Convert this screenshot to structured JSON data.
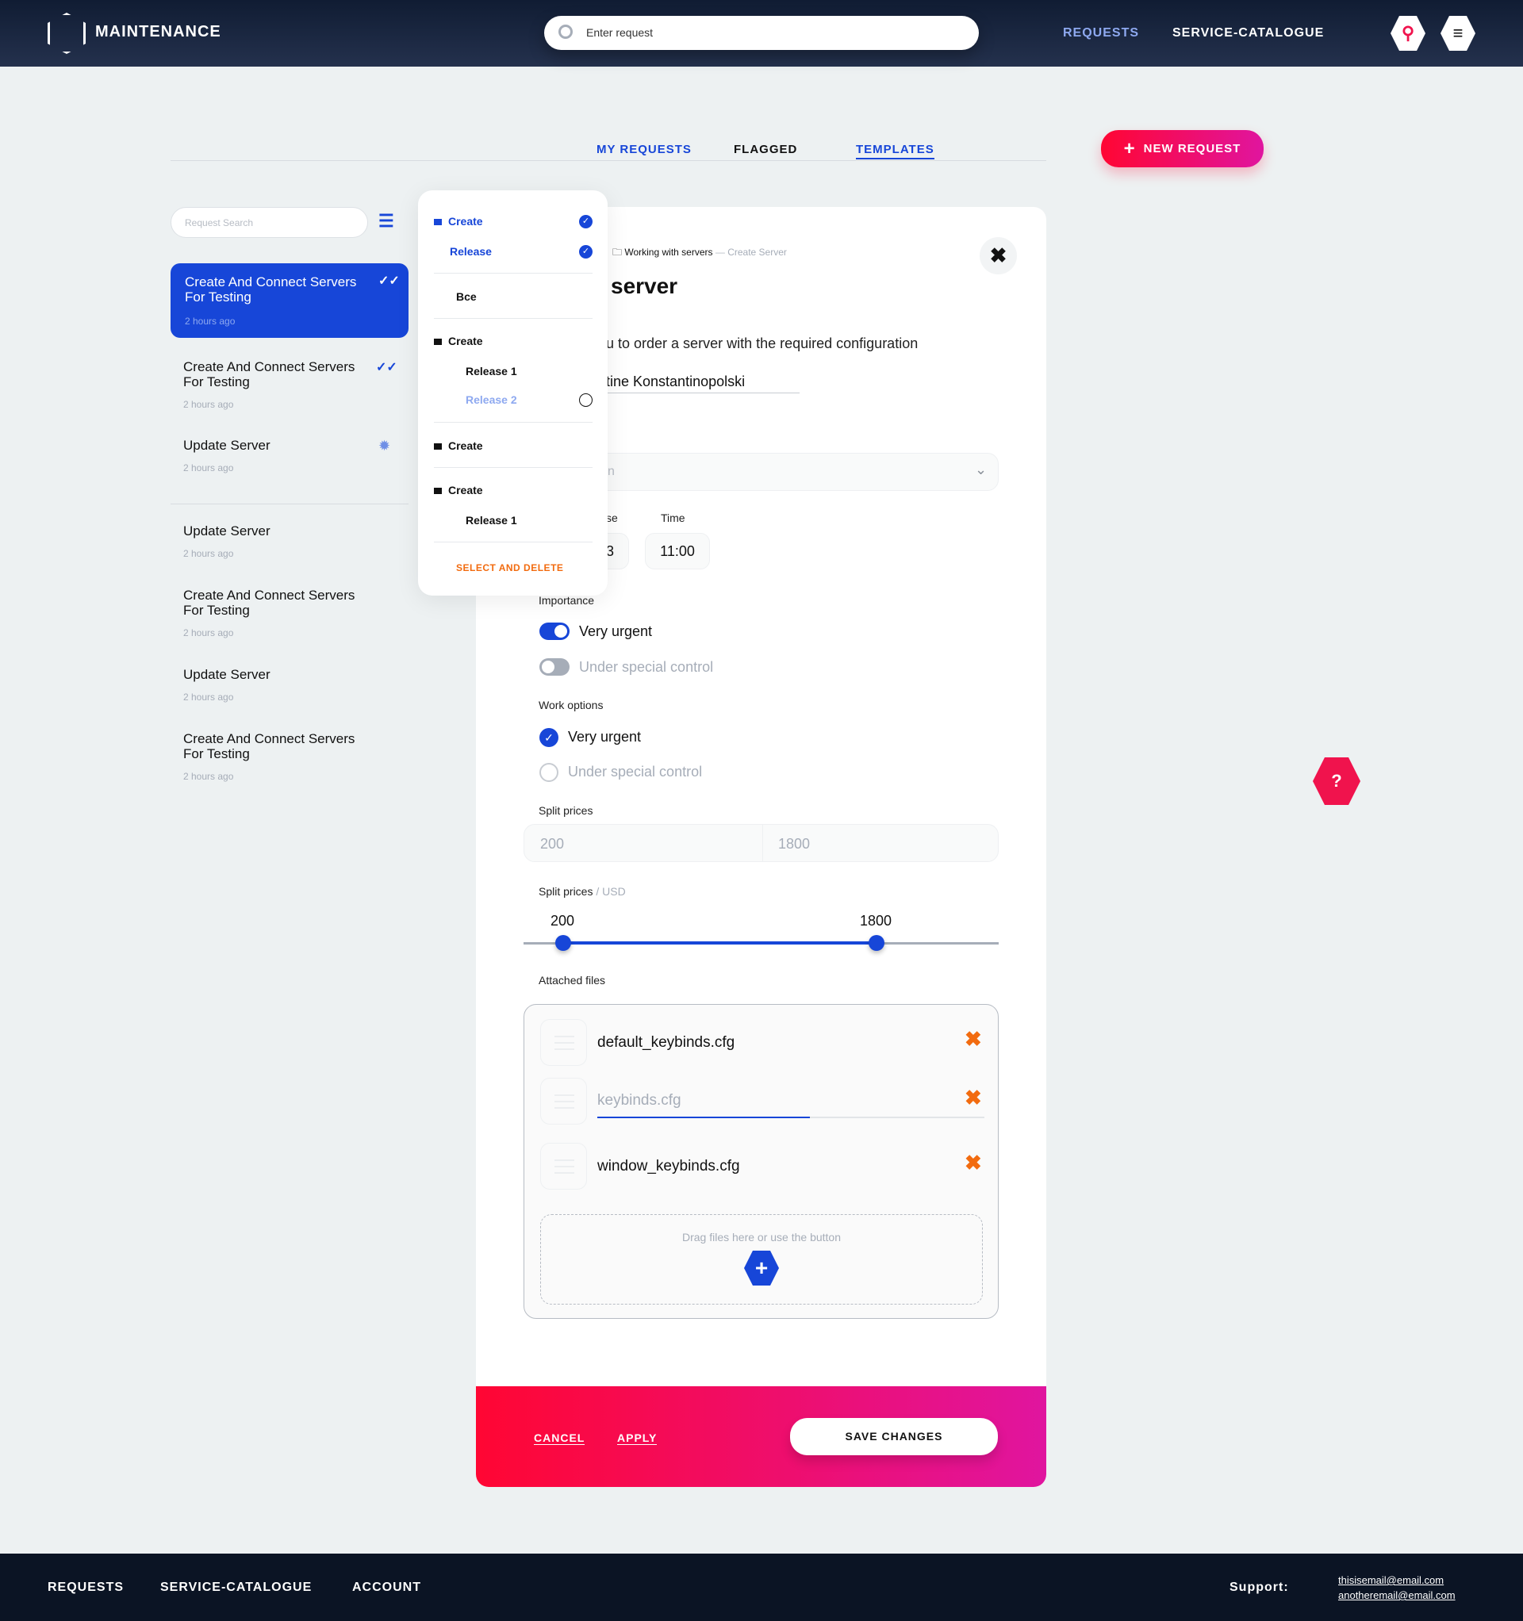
{
  "header": {
    "brand": "MAINTENANCE",
    "search_placeholder": "Enter request",
    "nav": [
      "REQUESTS",
      "SERVICE-CATALOGUE"
    ]
  },
  "tabs": [
    "MY REQUESTS",
    "FLAGGED",
    "TEMPLATES"
  ],
  "new_request": "NEW REQUEST",
  "sidebar": {
    "search_placeholder": "Request Search",
    "items": [
      {
        "title": "Create And Connect Servers For Testing",
        "time": "2 hours ago",
        "status": "done"
      },
      {
        "title": "Create And Connect Servers For Testing",
        "time": "2 hours ago",
        "status": "done"
      },
      {
        "title": "Update Server",
        "time": "2 hours ago",
        "status": "loading"
      },
      {
        "title": "Update Server",
        "time": "2 hours ago"
      },
      {
        "title": "Create And Connect Servers For Testing",
        "time": "2 hours ago"
      },
      {
        "title": "Update Server",
        "time": "2 hours ago"
      },
      {
        "title": "Create And Connect Servers For Testing",
        "time": "2 hours ago"
      }
    ]
  },
  "popover": {
    "items": [
      "Create",
      "Release",
      "Bce",
      "Create",
      "Release 1",
      "Release 2",
      "Create",
      "Create",
      "Release 1"
    ],
    "action": "SELECT AND DELETE"
  },
  "form": {
    "breadcrumb": [
      "Working with servers",
      "Create Server"
    ],
    "title": "server",
    "description": "u to order a server with the required configuration",
    "name_value": "tine Konstantinopolski",
    "select_value": "n",
    "date_label": "se",
    "date_value": "3",
    "time_label": "Time",
    "time_value": "11:00",
    "importance_label": "Importance",
    "importance": [
      {
        "label": "Very urgent",
        "on": true
      },
      {
        "label": "Under special control",
        "on": false
      }
    ],
    "work_label": "Work options",
    "work": [
      {
        "label": "Very urgent",
        "checked": true
      },
      {
        "label": "Under special control",
        "checked": false
      }
    ],
    "split_label": "Split prices",
    "split_min": "200",
    "split_max": "1800",
    "slider_label": "Split prices",
    "slider_unit": "/ USD",
    "slider_min": "200",
    "slider_max": "1800",
    "files_label": "Attached files",
    "files": [
      "default_keybinds.cfg",
      "keybinds.cfg",
      "window_keybinds.cfg"
    ],
    "upload_progress": 0.55,
    "drop_text": "Drag files here or use the button",
    "cancel": "CANCEL",
    "apply": "APPLY",
    "save": "SAVE CHANGES"
  },
  "footer": {
    "nav": [
      "REQUESTS",
      "SERVICE-CATALOGUE",
      "ACCOUNT"
    ],
    "support_label": "Support:",
    "emails": [
      "thisisemail@email.com",
      "anotheremail@email.com"
    ]
  },
  "colors": {
    "accent": "#1746d8",
    "brand_gradient": [
      "#ff0633",
      "#e0159f"
    ],
    "danger": "#f26b0f"
  }
}
